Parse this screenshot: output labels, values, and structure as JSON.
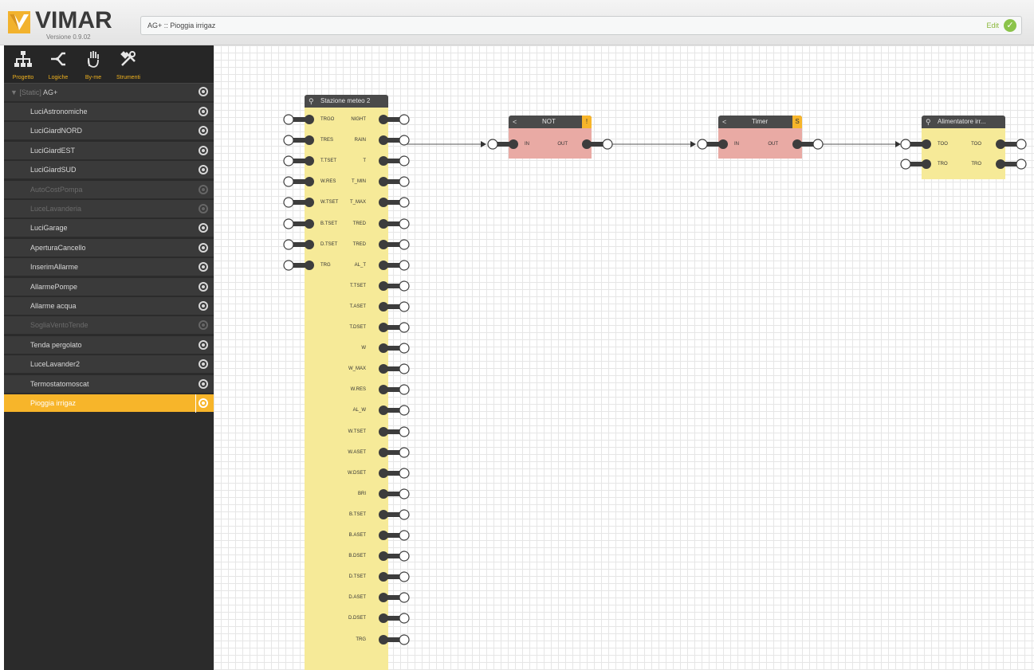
{
  "header": {
    "brand": "VIMAR",
    "version": "Versione 0.9.02",
    "breadcrumb": "AG+ :: Pioggia irrigaz",
    "edit_label": "Edit",
    "edit_icon": "check-circle-icon"
  },
  "toolbar": [
    {
      "label": "Progetto",
      "icon": "project-tree-icon",
      "active": true
    },
    {
      "label": "Logiche",
      "icon": "logic-icon",
      "active": false
    },
    {
      "label": "By-me",
      "icon": "hand-icon",
      "active": false
    },
    {
      "label": "Strumenti",
      "icon": "tools-icon",
      "active": false
    }
  ],
  "tree": {
    "root_prefix": "▼ [Static]",
    "root_label": "AG+",
    "items": [
      {
        "label": "LuciAstronomiche",
        "disabled": false,
        "selected": false
      },
      {
        "label": "LuciGiardNORD",
        "disabled": false,
        "selected": false
      },
      {
        "label": "LuciGiardEST",
        "disabled": false,
        "selected": false
      },
      {
        "label": "LuciGiardSUD",
        "disabled": false,
        "selected": false
      },
      {
        "label": "AutoCostPompa",
        "disabled": true,
        "selected": false
      },
      {
        "label": "LuceLavanderia",
        "disabled": true,
        "selected": false
      },
      {
        "label": "LuciGarage",
        "disabled": false,
        "selected": false
      },
      {
        "label": "AperturaCancello",
        "disabled": false,
        "selected": false
      },
      {
        "label": "InserimAllarme",
        "disabled": false,
        "selected": false
      },
      {
        "label": "AllarmePompe",
        "disabled": false,
        "selected": false
      },
      {
        "label": "Allarme acqua",
        "disabled": false,
        "selected": false
      },
      {
        "label": "SogliaVentoTende",
        "disabled": true,
        "selected": false
      },
      {
        "label": "Tenda pergolato",
        "disabled": false,
        "selected": false
      },
      {
        "label": "LuceLavander2",
        "disabled": false,
        "selected": false
      },
      {
        "label": "Termostatomoscat",
        "disabled": false,
        "selected": false
      },
      {
        "label": "Pioggia irrigaz",
        "disabled": false,
        "selected": true
      }
    ]
  },
  "blocks": {
    "station": {
      "title": "Stazione meteo 2",
      "icon": "device-icon",
      "inputs": [
        "TRGO",
        "TRES",
        "T.TSET",
        "W.RES",
        "W.TSET",
        "B.TSET",
        "D.TSET",
        "TRG"
      ],
      "outputs": [
        "NIGHT",
        "RAIN",
        "T",
        "T_MIN",
        "T_MAX",
        "TRED",
        "TRED",
        "AL_T",
        "T.TSET",
        "T.ASET",
        "T.DSET",
        "W",
        "W_MAX",
        "W.RES",
        "AL_W",
        "W.TSET",
        "W.ASET",
        "W.DSET",
        "BRI",
        "B.TSET",
        "B.ASET",
        "B.DSET",
        "D.TSET",
        "D.ASET",
        "D.DSET",
        "TRG"
      ]
    },
    "not": {
      "title": "NOT",
      "icon": "logic-icon",
      "badge": "!",
      "input": "IN",
      "output": "OUT"
    },
    "timer": {
      "title": "Timer",
      "icon": "logic-icon",
      "badge": "S",
      "input": "IN",
      "output": "OUT"
    },
    "supply": {
      "title": "Alimentatore irr...",
      "icon": "device-icon",
      "inputs": [
        "TOO",
        "TRO"
      ],
      "outputs": [
        "TOO",
        "TRO"
      ]
    }
  },
  "colors": {
    "accent": "#f7b52a",
    "device_block": "#f6ea98",
    "logic_block": "#e9aaa4",
    "sidebar": "#2b2b2b"
  }
}
